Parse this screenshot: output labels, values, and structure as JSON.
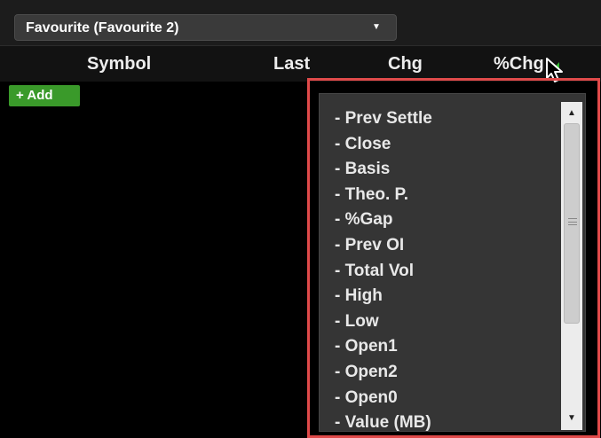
{
  "favourites": {
    "selected": "Favourite (Favourite 2)",
    "arrow_icon": "caret-down-icon"
  },
  "table": {
    "columns": [
      "Symbol",
      "Last",
      "Chg",
      "%Chg"
    ],
    "sort_indicator_color": "#2eb82e"
  },
  "add_button": {
    "label": "+ Add",
    "color": "#3a9a2a"
  },
  "dropdown": {
    "items": [
      "- Prev Settle",
      "- Close",
      "- Basis",
      "- Theo. P.",
      "- %Gap",
      "- Prev OI",
      "- Total Vol",
      "- High",
      "- Low",
      "- Open1",
      "- Open2",
      "- Open0",
      "- Value (MB)"
    ],
    "highlight_color": "#e04a4a"
  }
}
